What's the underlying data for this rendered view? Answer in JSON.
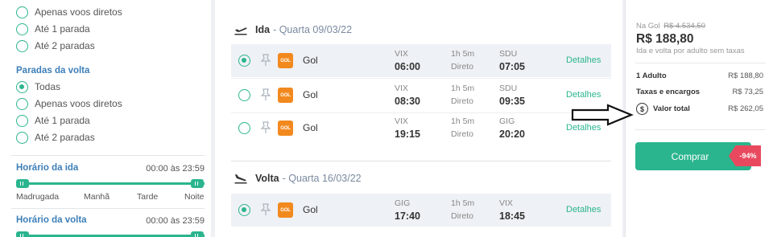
{
  "filters": {
    "ida_stops_visible": [
      {
        "label": "Apenas voos diretos",
        "selected": false
      },
      {
        "label": "Até 1 parada",
        "selected": false
      },
      {
        "label": "Até 2 paradas",
        "selected": false
      }
    ],
    "volta_title": "Paradas da volta",
    "volta_stops": [
      {
        "label": "Todas",
        "selected": true
      },
      {
        "label": "Apenas voos diretos",
        "selected": false
      },
      {
        "label": "Até 1 parada",
        "selected": false
      },
      {
        "label": "Até 2 paradas",
        "selected": false
      }
    ],
    "horario_ida": {
      "title": "Horário da ida",
      "range": "00:00 às 23:59",
      "labels": [
        "Madrugada",
        "Manhã",
        "Tarde",
        "Noite"
      ]
    },
    "horario_volta": {
      "title": "Horário da volta",
      "range": "00:00 às 23:59"
    }
  },
  "ida": {
    "label": "Ida",
    "date": "- Quarta 09/03/22",
    "flights": [
      {
        "airline": "Gol",
        "from": "VIX",
        "dep": "06:00",
        "duration": "1h 5m",
        "stops": "Direto",
        "to": "SDU",
        "arr": "07:05",
        "details": "Detalhes",
        "selected": true
      },
      {
        "airline": "Gol",
        "from": "VIX",
        "dep": "08:30",
        "duration": "1h 5m",
        "stops": "Direto",
        "to": "SDU",
        "arr": "09:35",
        "details": "Detalhes",
        "selected": false
      },
      {
        "airline": "Gol",
        "from": "VIX",
        "dep": "19:15",
        "duration": "1h 5m",
        "stops": "Direto",
        "to": "GIG",
        "arr": "20:20",
        "details": "Detalhes",
        "selected": false
      }
    ]
  },
  "volta": {
    "label": "Volta",
    "date": "- Quarta 16/03/22",
    "flights": [
      {
        "airline": "Gol",
        "from": "GIG",
        "dep": "17:40",
        "duration": "1h 5m",
        "stops": "Direto",
        "to": "VIX",
        "arr": "18:45",
        "details": "Detalhes",
        "selected": true
      }
    ]
  },
  "logo_text": "GOL",
  "price": {
    "na_gol_label": "Na Gol",
    "old_price": "R$ 4.534,50",
    "main_price": "R$ 188,80",
    "note": "Ida e volta por adulto sem taxas",
    "adult_label": "1 Adulto",
    "adult_value": "R$ 188,80",
    "taxes_label": "Taxas e encargos",
    "taxes_value": "R$ 73,25",
    "total_label": "Valor total",
    "total_value": "R$ 262,05",
    "dollar_symbol": "$",
    "buy_label": "Comprar",
    "discount": "-94%"
  },
  "colors": {
    "accent": "#2bb58e",
    "section_title": "#3c7fb8",
    "discount": "#e8495e",
    "airline_logo": "#f2891e"
  }
}
